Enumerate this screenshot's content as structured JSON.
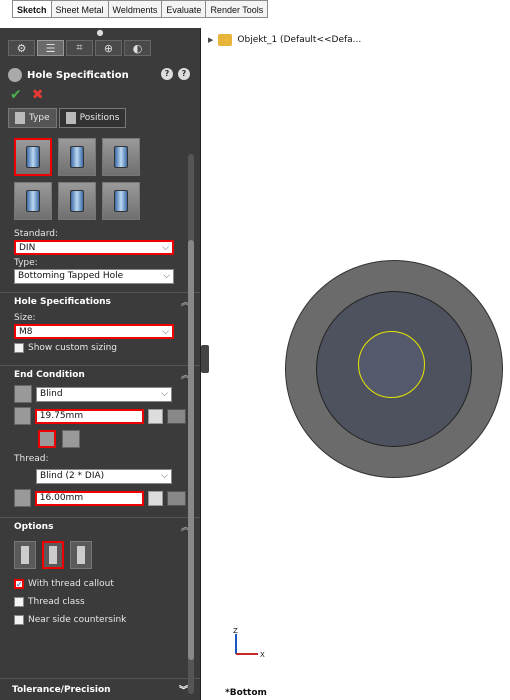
{
  "tabs": [
    "Sketch",
    "Sheet Metal",
    "Weldments",
    "Evaluate",
    "Render Tools"
  ],
  "active_tab": "Sketch",
  "panel": {
    "title": "Hole Specification",
    "type_tab": "Type",
    "positions_tab": "Positions",
    "standard_label": "Standard:",
    "standard_value": "DIN",
    "type_label": "Type:",
    "type_value": "Bottoming Tapped Hole",
    "hole_spec_title": "Hole Specifications",
    "size_label": "Size:",
    "size_value": "M8",
    "show_custom_sizing": "Show custom sizing",
    "end_condition_title": "End Condition",
    "end_condition_value": "Blind",
    "depth_value": "19.75mm",
    "thread_label": "Thread:",
    "thread_value": "Blind (2 * DIA)",
    "thread_depth_value": "16.00mm",
    "options_title": "Options",
    "with_thread_callout": "With thread callout",
    "thread_class": "Thread class",
    "near_side_countersink": "Near side countersink",
    "tolerance_title": "Tolerance/Precision"
  },
  "tree": {
    "item": "Objekt_1 (Default<<Defa..."
  },
  "view": {
    "orientation": "*Bottom",
    "axis_z": "Z",
    "axis_x": "X"
  },
  "colors": {
    "panel_bg": "#3b3b3b",
    "selection_red": "#e00000",
    "circle_highlight": "#e6e600"
  }
}
